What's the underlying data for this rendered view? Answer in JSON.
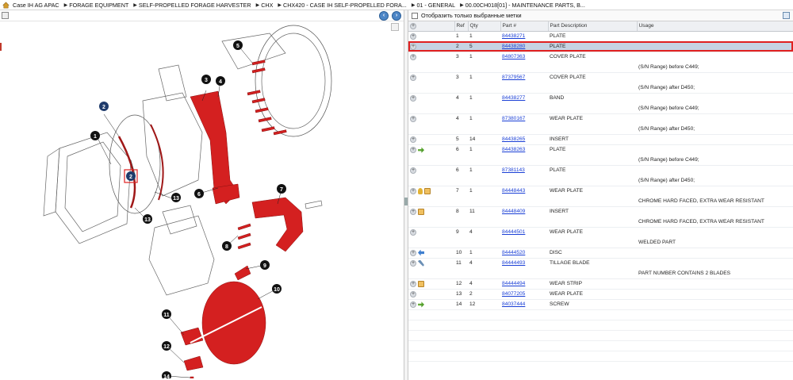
{
  "breadcrumb": [
    "Case IH AG APAC",
    "FORAGE EQUIPMENT",
    "SELF-PROPELLED FORAGE HARVESTER",
    "CHX",
    "CHX420 - CASE IH SELF-PROPELLED FORA...",
    "01 - GENERAL",
    "00.00CH018[01] - MAINTENANCE PARTS, B..."
  ],
  "filter": {
    "label": "Отобразить только выбранные метки"
  },
  "table": {
    "columns": [
      "Ref",
      "Qty",
      "Part #",
      "Part Description",
      "Usage"
    ],
    "rows": [
      {
        "icons": [],
        "ref": "1",
        "qty": "1",
        "part": "84438271",
        "desc": "PLATE",
        "usage": "",
        "selected": false
      },
      {
        "icons": [],
        "ref": "2",
        "qty": "5",
        "part": "84438280",
        "desc": "PLATE",
        "usage": "",
        "selected": true
      },
      {
        "icons": [],
        "ref": "3",
        "qty": "1",
        "part": "84807363",
        "desc": "COVER PLATE",
        "usage": "(S/N Range) before C449;",
        "selected": false
      },
      {
        "icons": [],
        "ref": "3",
        "qty": "1",
        "part": "87379567",
        "desc": "COVER PLATE",
        "usage": "(S/N Range) after D450;",
        "selected": false
      },
      {
        "icons": [],
        "ref": "4",
        "qty": "1",
        "part": "84438277",
        "desc": "BAND",
        "usage": "(S/N Range) before C449;",
        "selected": false
      },
      {
        "icons": [],
        "ref": "4",
        "qty": "1",
        "part": "87380167",
        "desc": "WEAR PLATE",
        "usage": "(S/N Range) after D450;",
        "selected": false
      },
      {
        "icons": [],
        "ref": "5",
        "qty": "14",
        "part": "84438265",
        "desc": "INSERT",
        "usage": "",
        "selected": false
      },
      {
        "icons": [
          "arrow"
        ],
        "ref": "6",
        "qty": "1",
        "part": "84438263",
        "desc": "PLATE",
        "usage": "(S/N Range) before C449;",
        "selected": false
      },
      {
        "icons": [],
        "ref": "6",
        "qty": "1",
        "part": "87381143",
        "desc": "PLATE",
        "usage": "(S/N Range) after D450;",
        "selected": false
      },
      {
        "icons": [
          "key",
          "box"
        ],
        "ref": "7",
        "qty": "1",
        "part": "84448443",
        "desc": "WEAR PLATE",
        "usage": "CHROME HARD FACED, EXTRA WEAR RESISTANT",
        "selected": false
      },
      {
        "icons": [
          "box"
        ],
        "ref": "8",
        "qty": "11",
        "part": "84448409",
        "desc": "INSERT",
        "usage": "CHROME HARD FACED, EXTRA WEAR RESISTANT",
        "selected": false
      },
      {
        "icons": [],
        "ref": "9",
        "qty": "4",
        "part": "84444501",
        "desc": "WEAR PLATE",
        "usage": "WELDED PART",
        "selected": false
      },
      {
        "icons": [
          "blue"
        ],
        "ref": "10",
        "qty": "1",
        "part": "84444520",
        "desc": "DISC",
        "usage": "",
        "selected": false
      },
      {
        "icons": [
          "tool"
        ],
        "ref": "11",
        "qty": "4",
        "part": "84444493",
        "desc": "TILLAGE BLADE",
        "usage": "PART NUMBER CONTAINS 2 BLADES",
        "selected": false
      },
      {
        "icons": [
          "box"
        ],
        "ref": "12",
        "qty": "4",
        "part": "84444494",
        "desc": "WEAR STRIP",
        "usage": "",
        "selected": false
      },
      {
        "icons": [],
        "ref": "13",
        "qty": "2",
        "part": "84077205",
        "desc": "WEAR PLATE",
        "usage": "",
        "selected": false
      },
      {
        "icons": [
          "arrow"
        ],
        "ref": "14",
        "qty": "12",
        "part": "84037444",
        "desc": "SCREW",
        "usage": "",
        "selected": false
      }
    ]
  },
  "diagram": {
    "callouts": [
      "1",
      "2",
      "3",
      "4",
      "5",
      "6",
      "7",
      "8",
      "9",
      "10",
      "11",
      "12",
      "13",
      "13",
      "14"
    ],
    "highlight_color": "#d42020",
    "selected_callout": "2"
  },
  "colors": {
    "part_red": "#d42020",
    "selected_row": "#c6d3e3",
    "link": "#1a3fd6",
    "nav_button": "#4d86c6"
  },
  "icons": {
    "home": "home-icon",
    "nav_back": "arrow-left-icon",
    "nav_forward": "arrow-right-icon",
    "export": "export-icon"
  }
}
